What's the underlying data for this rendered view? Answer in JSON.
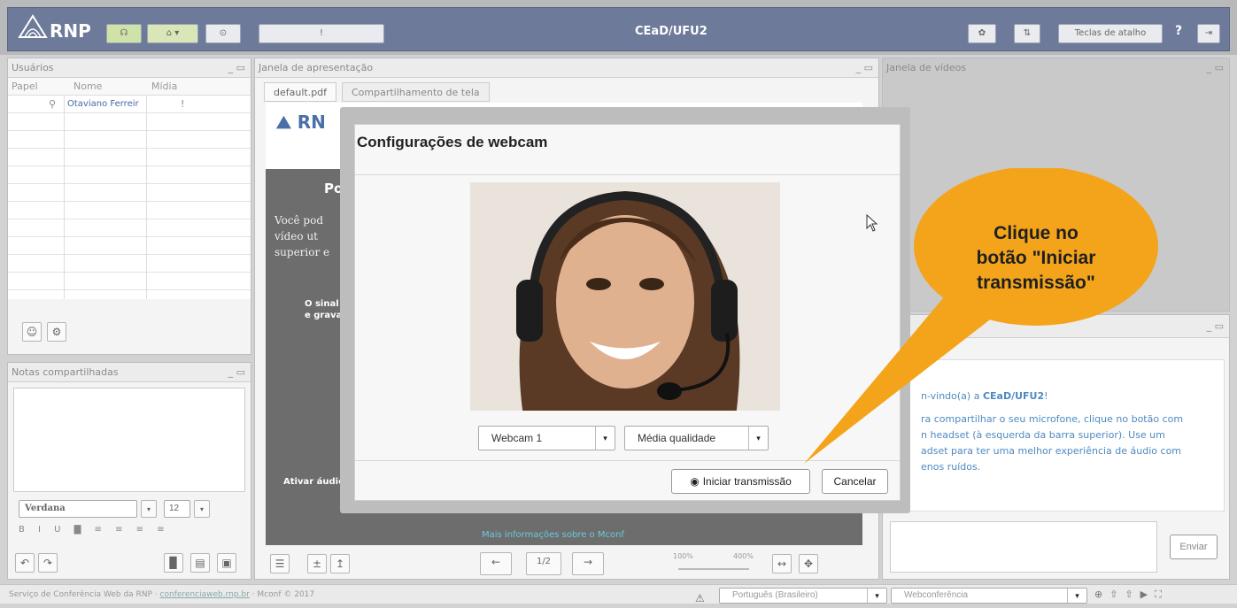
{
  "topbar": {
    "logo_text": "RNP",
    "conference_title": "CEaD/UFU2",
    "shortcuts_label": "Teclas de atalho",
    "help_label": "?"
  },
  "users_panel": {
    "title": "Usuários",
    "columns": [
      "Papel",
      "Nome",
      "Mídia"
    ],
    "rows": [
      {
        "name": "Otaviano Ferreir"
      }
    ]
  },
  "notes_panel": {
    "title": "Notas compartilhadas",
    "font": "Verdana",
    "font_size": "12"
  },
  "presentation": {
    "title": "Janela de apresentação",
    "tabs": [
      "default.pdf",
      "Compartilhamento de tela"
    ],
    "page": "1/2",
    "zoom_min": "100%",
    "zoom_max": "400%",
    "slide": {
      "heading_fragment": "Po",
      "text1": "Você pod",
      "text2": "vídeo ut",
      "text3": "superior e",
      "signal": "O sinal",
      "grava": "e grava",
      "audio": "Ativar áudio",
      "link": "Mais informações sobre o Mconf"
    }
  },
  "video_panel": {
    "title": "Janela de vídeos"
  },
  "chat": {
    "welcome_prefix": "n-vindo(a) a ",
    "welcome_name": "CEaD/UFU2",
    "welcome_suffix": "!",
    "lines": [
      "ra compartilhar o seu microfone, clique no botão com",
      "n headset (à esquerda da barra superior). Use um",
      "adset para ter uma melhor experiência de áudio com",
      "enos ruídos."
    ],
    "send_label": "Enviar"
  },
  "modal": {
    "title": "Configurações de webcam",
    "camera_select": "Webcam 1",
    "quality_select": "Média qualidade",
    "start_button": "Iniciar transmissão",
    "cancel_button": "Cancelar"
  },
  "callout": {
    "text_line1": "Clique no",
    "text_line2": "botão \"Iniciar",
    "text_line3": "transmissão\"",
    "color": "#f4a51c"
  },
  "footer": {
    "service_text": "Serviço de Conferência Web da RNP · ",
    "link": "conferenciaweb.rnp.br",
    "suffix": " · Mconf © 2017",
    "language": "Português (Brasileiro)",
    "layout": "Webconferência"
  }
}
